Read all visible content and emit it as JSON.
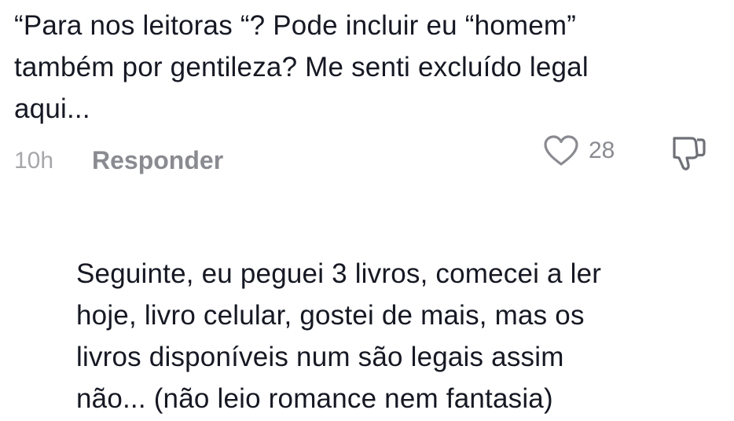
{
  "comments": [
    {
      "text": "“Para nos leitoras “? Pode incluir eu “homem”\ntambém por gentileza? Me senti excluído legal\naqui...",
      "time": "10h",
      "reply_label": "Responder",
      "like_count": "28",
      "icons": {
        "like": "heart-outline-icon",
        "dislike": "thumbs-down-outline-icon"
      },
      "colors": {
        "meta_text": "#8a8b91",
        "timestamp": "#a7a7ab",
        "body_text": "#161823"
      }
    },
    {
      "text": "Seguinte, eu peguei 3 livros, comecei a ler\nhoje, livro celular, gostei de mais, mas os\nlivros disponíveis num são legais assim\nnão... (não leio romance nem fantasia)"
    }
  ]
}
